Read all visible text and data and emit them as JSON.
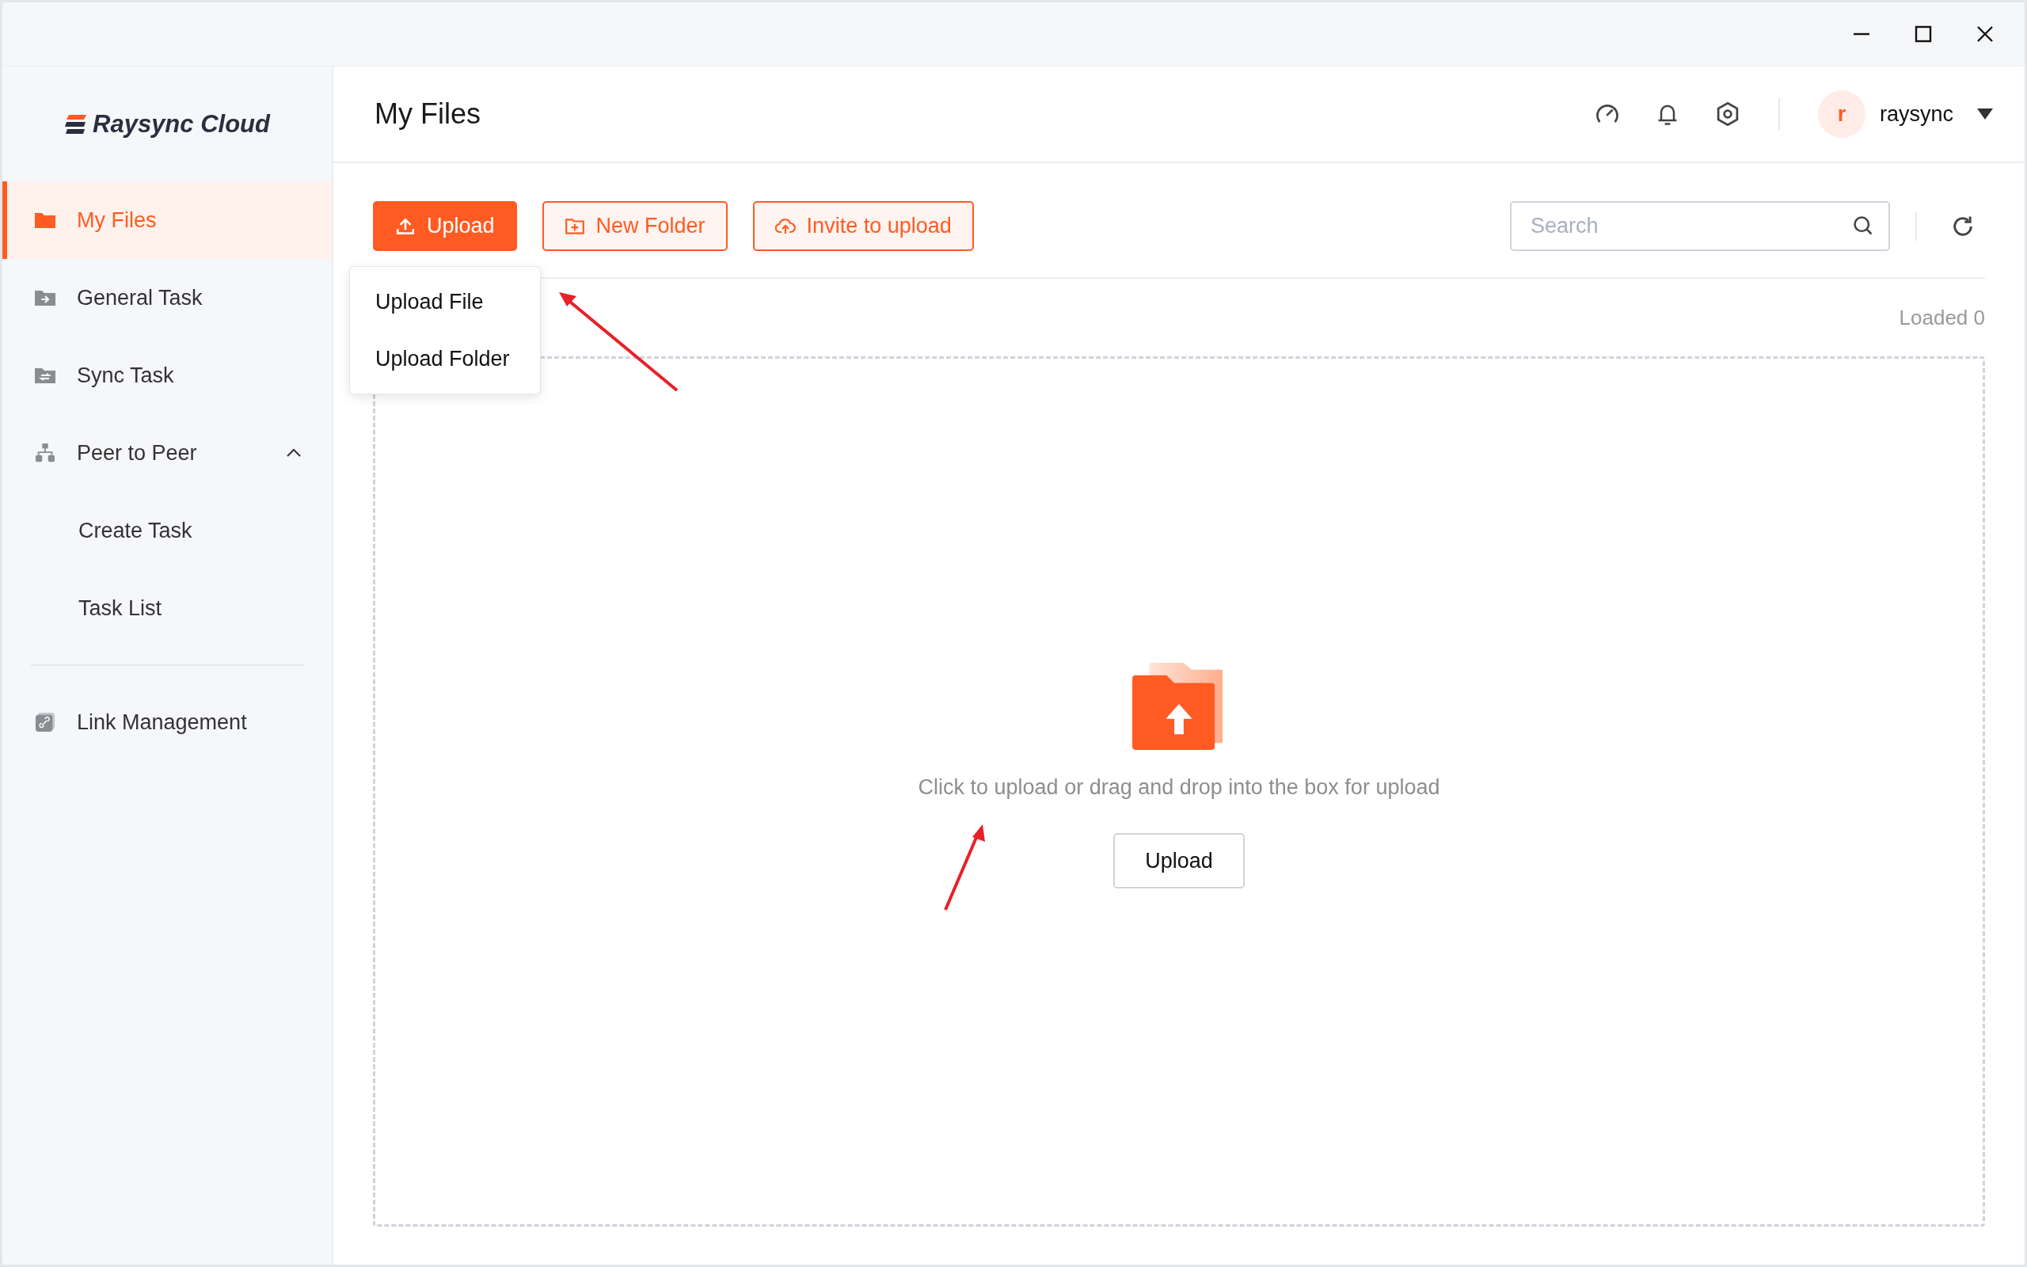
{
  "logo": {
    "text": "Raysync Cloud"
  },
  "sidebar": {
    "items": [
      {
        "label": "My Files",
        "selected": true
      },
      {
        "label": "General Task",
        "selected": false
      },
      {
        "label": "Sync Task",
        "selected": false
      },
      {
        "label": "Peer to Peer",
        "selected": false,
        "expanded": true,
        "children": [
          {
            "label": "Create Task",
            "selected": false
          },
          {
            "label": "Task List",
            "selected": false
          }
        ]
      }
    ],
    "bottom_items": [
      {
        "label": "Link Management",
        "selected": false
      }
    ]
  },
  "header": {
    "title": "My Files",
    "user": {
      "initial": "r",
      "name": "raysync"
    }
  },
  "toolbar": {
    "buttons": [
      {
        "label": "Upload",
        "kind": "primary"
      },
      {
        "label": "New Folder",
        "kind": "outline"
      },
      {
        "label": "Invite to upload",
        "kind": "outline"
      }
    ],
    "search": {
      "placeholder": "Search"
    }
  },
  "upload_menu": {
    "open": true,
    "items": [
      "Upload File",
      "Upload Folder"
    ]
  },
  "loaded": "Loaded 0",
  "dropzone": {
    "hint": "Click to upload or drag and drop into the box for upload",
    "button": "Upload"
  }
}
